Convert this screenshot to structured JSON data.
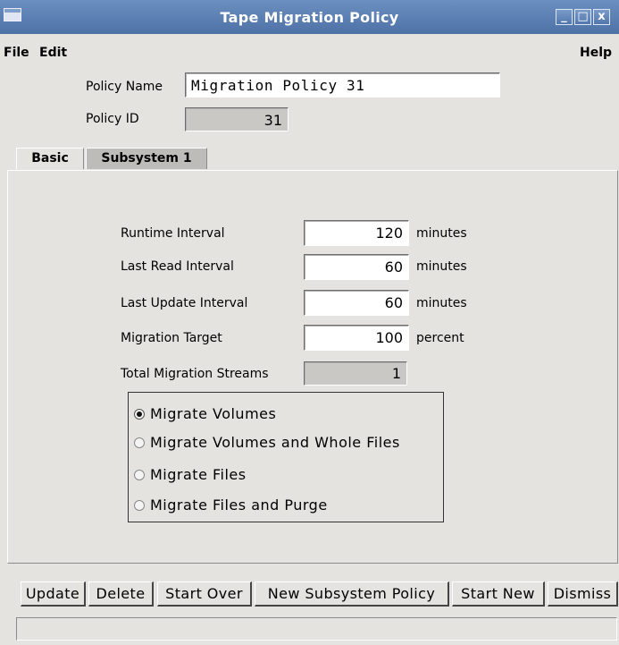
{
  "window": {
    "title": "Tape Migration Policy",
    "controls": [
      "_",
      "□",
      "x"
    ]
  },
  "menu": {
    "file": "File",
    "edit": "Edit",
    "help": "Help"
  },
  "header": {
    "policy_name_label": "Policy Name",
    "policy_name_value": "Migration Policy 31",
    "policy_id_label": "Policy ID",
    "policy_id_value": "31"
  },
  "tabs": [
    {
      "label": "Basic",
      "active": true
    },
    {
      "label": "Subsystem 1",
      "active": false
    }
  ],
  "fields": {
    "runtime": {
      "label": "Runtime Interval",
      "value": "120",
      "unit": "minutes"
    },
    "last_read": {
      "label": "Last Read Interval",
      "value": "60",
      "unit": "minutes"
    },
    "last_update": {
      "label": "Last Update Interval",
      "value": "60",
      "unit": "minutes"
    },
    "target": {
      "label": "Migration Target",
      "value": "100",
      "unit": "percent"
    },
    "streams": {
      "label": "Total Migration Streams",
      "value": "1"
    }
  },
  "options": [
    {
      "label": "Migrate Volumes",
      "selected": true
    },
    {
      "label": "Migrate Volumes and Whole Files",
      "selected": false
    },
    {
      "label": "Migrate Files",
      "selected": false
    },
    {
      "label": "Migrate Files and Purge",
      "selected": false
    }
  ],
  "buttons": {
    "update": "Update",
    "delete": "Delete",
    "start_over": "Start Over",
    "new_subsystem_policy": "New Subsystem Policy",
    "start_new": "Start New",
    "dismiss": "Dismiss"
  },
  "status_text": ""
}
